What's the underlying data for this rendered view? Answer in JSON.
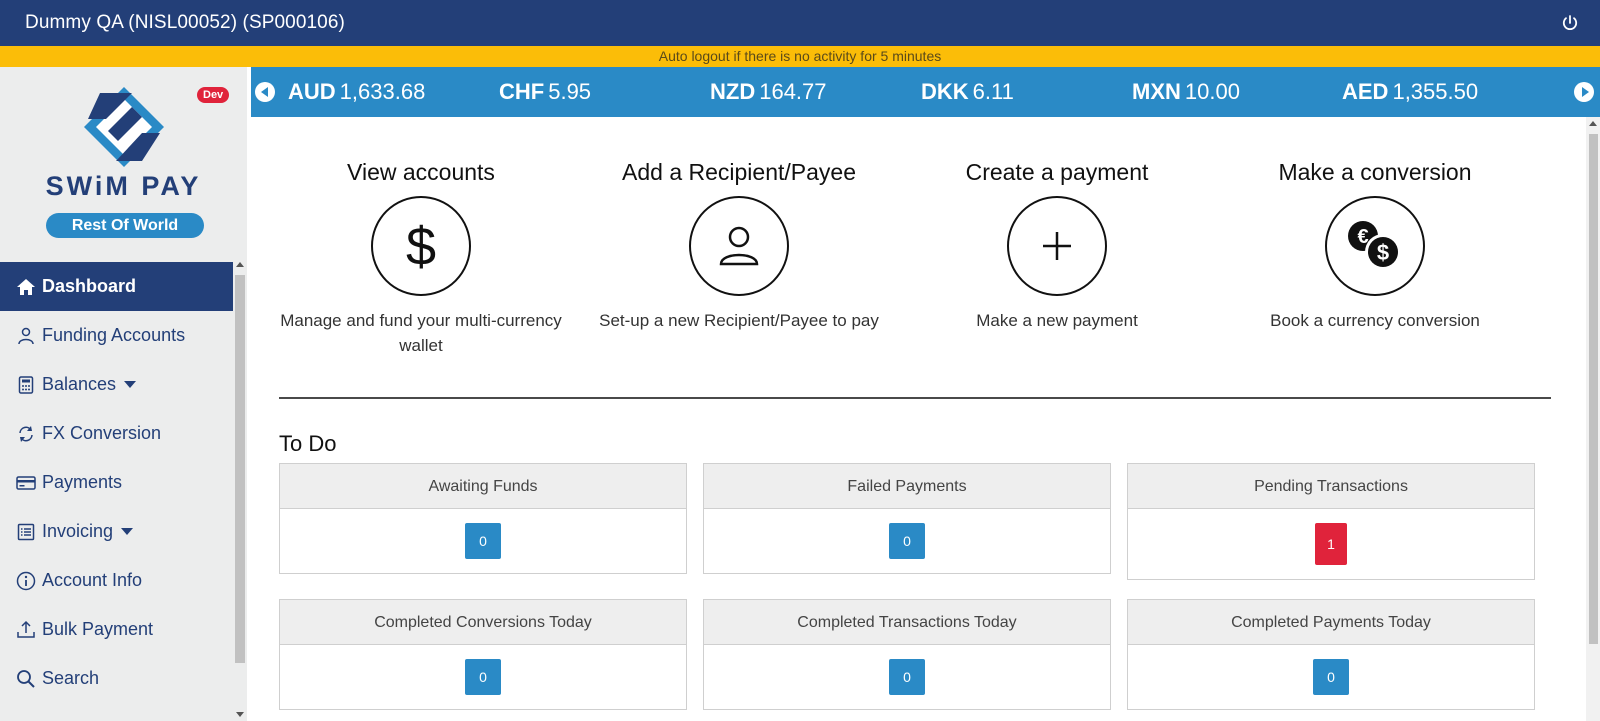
{
  "header": {
    "title": "Dummy QA (NISL00052) (SP000106)",
    "power_icon": "power-icon"
  },
  "notice": {
    "text": "Auto logout if there is no activity for 5 minutes"
  },
  "sidebar": {
    "dev_badge": "Dev",
    "brand": "SWiM PAY",
    "region": "Rest Of World",
    "items": [
      {
        "label": "Dashboard",
        "icon": "home-icon",
        "active": true
      },
      {
        "label": "Funding Accounts",
        "icon": "user-icon"
      },
      {
        "label": "Balances",
        "icon": "calculator-icon",
        "dropdown": true
      },
      {
        "label": "FX Conversion",
        "icon": "refresh-icon"
      },
      {
        "label": "Payments",
        "icon": "card-icon"
      },
      {
        "label": "Invoicing",
        "icon": "list-icon",
        "dropdown": true
      },
      {
        "label": "Account Info",
        "icon": "info-icon"
      },
      {
        "label": "Bulk Payment",
        "icon": "upload-icon"
      },
      {
        "label": "Search",
        "icon": "search-icon"
      }
    ]
  },
  "ticker": {
    "rates": [
      {
        "code": "AUD",
        "value": "1,633.68"
      },
      {
        "code": "CHF",
        "value": "5.95"
      },
      {
        "code": "NZD",
        "value": "164.77"
      },
      {
        "code": "DKK",
        "value": "6.11"
      },
      {
        "code": "MXN",
        "value": "10.00"
      },
      {
        "code": "AED",
        "value": "1,355.50"
      }
    ]
  },
  "actions": [
    {
      "title": "View accounts",
      "desc": "Manage and fund your multi-currency wallet",
      "icon": "dollar-icon"
    },
    {
      "title": "Add a Recipient/Payee",
      "desc": "Set-up a new Recipient/Payee to pay",
      "icon": "person-icon"
    },
    {
      "title": "Create a payment",
      "desc": "Make a new payment",
      "icon": "plus-icon"
    },
    {
      "title": "Make a conversion",
      "desc": "Book a currency conversion",
      "icon": "currency-exchange-icon"
    }
  ],
  "todo": {
    "title": "To Do",
    "cards": [
      {
        "label": "Awaiting Funds",
        "count": "0",
        "status": "info"
      },
      {
        "label": "Failed Payments",
        "count": "0",
        "status": "info"
      },
      {
        "label": "Pending Transactions",
        "count": "1",
        "status": "alert"
      },
      {
        "label": "Completed Conversions Today",
        "count": "0",
        "status": "info"
      },
      {
        "label": "Completed Transactions Today",
        "count": "0",
        "status": "info"
      },
      {
        "label": "Completed Payments Today",
        "count": "0",
        "status": "info"
      }
    ]
  },
  "colors": {
    "primary": "#233f78",
    "accent": "#2a8ac6",
    "warning": "#fbbd08",
    "danger": "#e0233b"
  }
}
